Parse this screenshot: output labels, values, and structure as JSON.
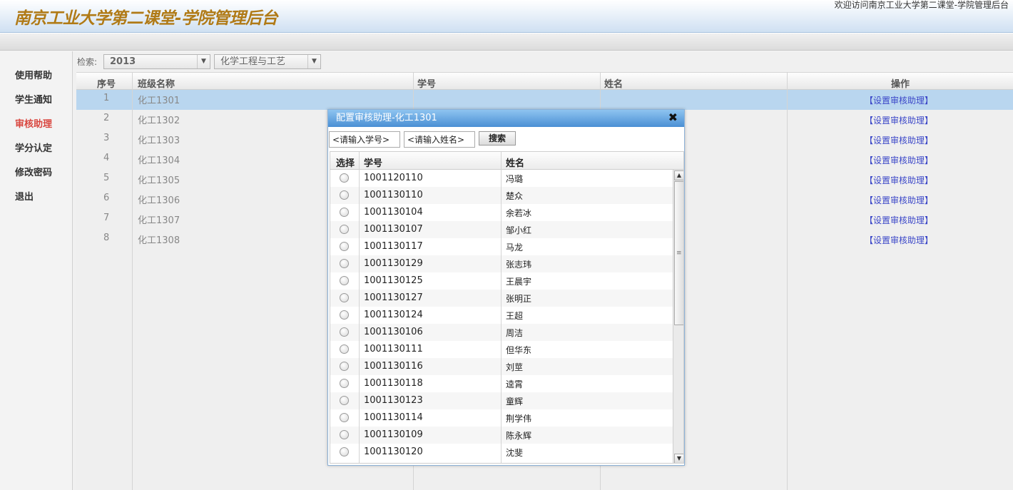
{
  "header": {
    "title": "南京工业大学第二课堂-学院管理后台",
    "welcome": "欢迎访问南京工业大学第二课堂-学院管理后台"
  },
  "sidebar": {
    "items": [
      {
        "label": "使用帮助"
      },
      {
        "label": "学生通知"
      },
      {
        "label": "审核助理",
        "active": true
      },
      {
        "label": "学分认定"
      },
      {
        "label": "修改密码"
      },
      {
        "label": "退出"
      }
    ]
  },
  "search": {
    "label": "检索:",
    "year": "2013",
    "major": "化学工程与工艺"
  },
  "table": {
    "headers": {
      "index": "序号",
      "class_name": "班级名称",
      "student_id": "学号",
      "name": "姓名",
      "action": "操作"
    },
    "action_label": "【设置审核助理】",
    "rows": [
      {
        "index": "1",
        "class_name": "化工1301"
      },
      {
        "index": "2",
        "class_name": "化工1302"
      },
      {
        "index": "3",
        "class_name": "化工1303"
      },
      {
        "index": "4",
        "class_name": "化工1304"
      },
      {
        "index": "5",
        "class_name": "化工1305"
      },
      {
        "index": "6",
        "class_name": "化工1306"
      },
      {
        "index": "7",
        "class_name": "化工1307"
      },
      {
        "index": "8",
        "class_name": "化工1308"
      }
    ]
  },
  "dialog": {
    "title": "配置审核助理-化工1301",
    "close": "✖",
    "id_placeholder": "<请输入学号>",
    "name_placeholder": "<请输入姓名>",
    "search_button": "搜索",
    "headers": {
      "select": "选择",
      "student_id": "学号",
      "name": "姓名"
    },
    "rows": [
      {
        "id": "1001120110",
        "name": "冯璐"
      },
      {
        "id": "1001130110",
        "name": "楚众"
      },
      {
        "id": "1001130104",
        "name": "余若冰"
      },
      {
        "id": "1001130107",
        "name": "邹小红"
      },
      {
        "id": "1001130117",
        "name": "马龙"
      },
      {
        "id": "1001130129",
        "name": "张志玮"
      },
      {
        "id": "1001130125",
        "name": "王晨宇"
      },
      {
        "id": "1001130127",
        "name": "张明正"
      },
      {
        "id": "1001130124",
        "name": "王超"
      },
      {
        "id": "1001130106",
        "name": "周洁"
      },
      {
        "id": "1001130111",
        "name": "但华东"
      },
      {
        "id": "1001130116",
        "name": "刘莖"
      },
      {
        "id": "1001130118",
        "name": "逵霄"
      },
      {
        "id": "1001130123",
        "name": "童辉"
      },
      {
        "id": "1001130114",
        "name": "荆学伟"
      },
      {
        "id": "1001130109",
        "name": "陈永辉"
      },
      {
        "id": "1001130120",
        "name": "沈斐"
      }
    ]
  },
  "colors": {
    "title": "#b07a16",
    "active_menu": "#d9463f",
    "link": "#3a46c8",
    "selected_row": "#b9d6ef"
  }
}
